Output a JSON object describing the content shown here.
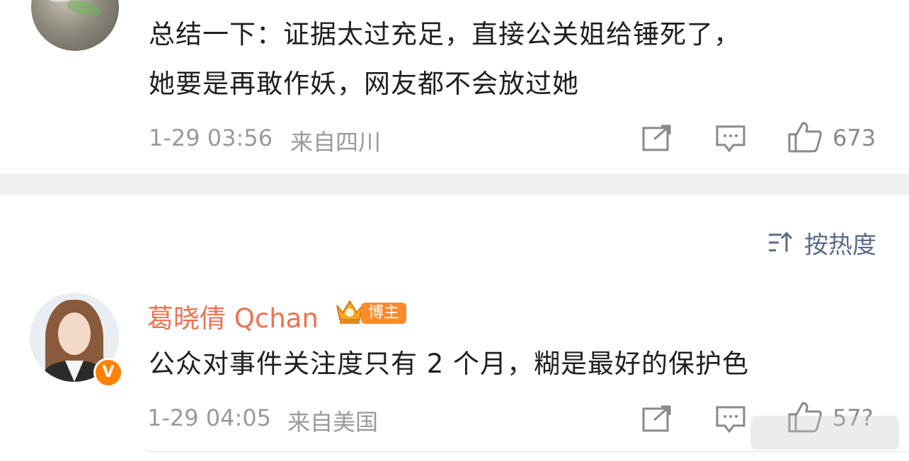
{
  "comment1": {
    "text_line1": "总结一下：证据太过充足，直接公关姐给锤死了，",
    "text_line2": "她要是再敢作妖，网友都不会放过她",
    "time": "1-29 03:56",
    "location": "来自四川",
    "likes": "673"
  },
  "sort": {
    "label": "按热度",
    "icon": "sort-icon"
  },
  "comment2": {
    "username": "葛晓倩 Qchan",
    "badge_label": "博主",
    "verified_badge": "V",
    "text": "公众对事件关注度只有 2 个月，糊是最好的保护色",
    "time": "1-29 04:05",
    "location": "来自美国",
    "likes": "57?"
  },
  "colors": {
    "username": "#eb7350",
    "sort": "#5b6b8c",
    "badge": "#ff8a2a",
    "verified": "#ff8200"
  },
  "icons": [
    "share-icon",
    "comment-icon",
    "like-icon"
  ]
}
